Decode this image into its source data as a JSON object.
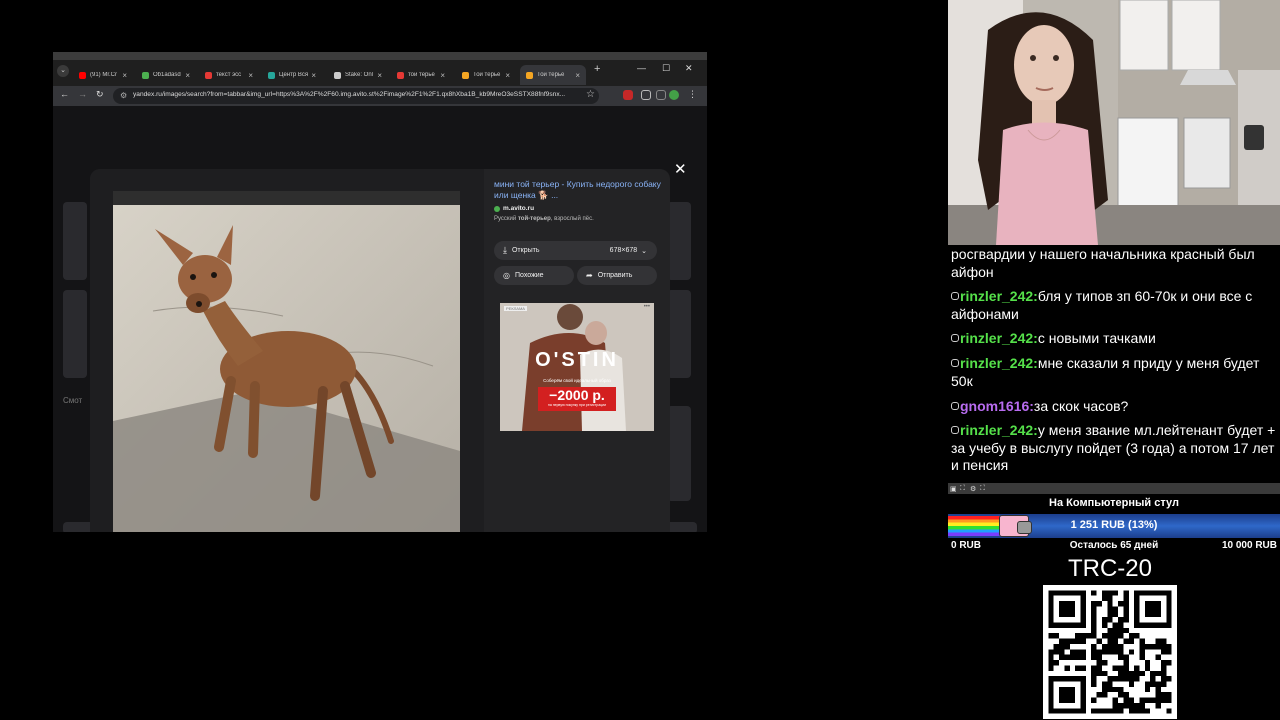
{
  "browser": {
    "tabs": [
      {
        "title": "(91) Mr.Cr",
        "color": "#ff0000"
      },
      {
        "title": "Ob1adasd",
        "color": "#4caf50"
      },
      {
        "title": "текст эсс",
        "color": "#e53935"
      },
      {
        "title": "Центр Вся",
        "color": "#26a69a"
      },
      {
        "title": "Stake: Onl",
        "color": "#cccccc"
      },
      {
        "title": "той терье",
        "color": "#e53935"
      },
      {
        "title": "Той терье",
        "color": "#f5a623"
      },
      {
        "title": "Той терье",
        "color": "#f5a623"
      }
    ],
    "url": "yandex.ru/images/search?from=tabbar&img_url=https%3A%2F%2F60.img.avito.st%2Fimage%2F1%2F1.qx8hXba1B_kb9MreO3eSSTX88fnf9snx..."
  },
  "viewer": {
    "title": "мини той терьер - Купить недорого собаку или щенка 🐕 ...",
    "site": "m.avito.ru",
    "desc_prefix": "Русский ",
    "desc_bold": "той-терьер",
    "desc_suffix": ", взрослый пёс.",
    "open_label": "Открыть",
    "size_label": "678×678",
    "similar_label": "Похожие",
    "share_label": "Отправить",
    "ad": {
      "label": "РЕКЛАМА",
      "brand": "O'STIN",
      "subtitle": "Соберём свой идеальный образ",
      "price": "−2000 р.",
      "price_note": "на первую покупку при регистрации"
    },
    "bg_label": "Смот"
  },
  "chat": {
    "messages": [
      {
        "user": "",
        "text": "росгвардии у нашего начальника красный был айфон"
      },
      {
        "user": "rinzler_242:",
        "color": "green",
        "text": "бля у типов зп 60-70к и они все с айфонами"
      },
      {
        "user": "rinzler_242:",
        "color": "green",
        "text": "с новыми тачками"
      },
      {
        "user": "rinzler_242:",
        "color": "green",
        "text": "мне сказали я приду у меня будет 50к"
      },
      {
        "user": "gnom1616:",
        "color": "purple",
        "text": "за скок часов?"
      },
      {
        "user": "rinzler_242:",
        "color": "green",
        "text": "у меня звание мл.лейтенант будет + за учебу в выслугу пойдет (3 года) а потом 17 лет и пенсия"
      }
    ]
  },
  "donation": {
    "title": "На Компьютерный стул",
    "current": "1 251 RUB (13%)",
    "progress": 0.13,
    "min": "0 RUB",
    "remaining": "Осталось 65 дней",
    "max": "10 000 RUB"
  },
  "crypto": {
    "label": "TRC-20"
  }
}
